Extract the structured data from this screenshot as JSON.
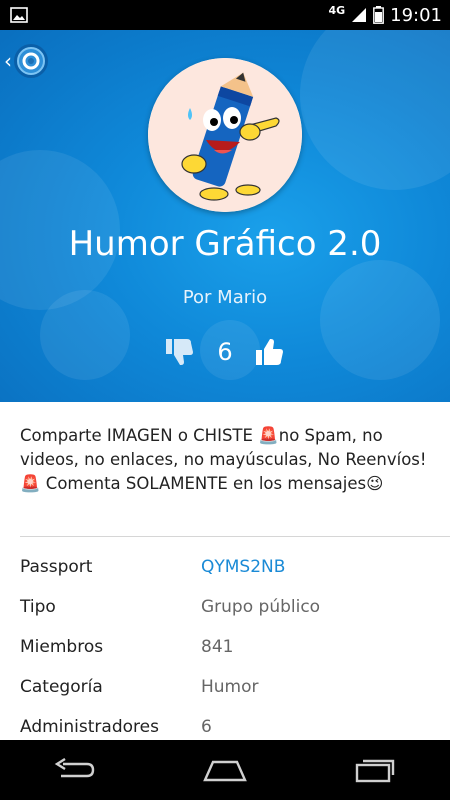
{
  "status_bar": {
    "network": "4G",
    "time": "19:01"
  },
  "group": {
    "title": "Humor Gráfico 2.0",
    "author": "Por Mario",
    "vote_count": "6",
    "description_parts": [
      "Comparte IMAGEN o CHISTE ",
      "🚨",
      "no Spam, no videos, no enlaces, no mayúsculas, No Reenvíos!",
      "🚨",
      " Comenta SOLAMENTE en los mensajes",
      "😉"
    ]
  },
  "info": {
    "rows": [
      {
        "label": "Passport",
        "value": "QYMS2NB"
      },
      {
        "label": "Tipo",
        "value": "Grupo público"
      },
      {
        "label": "Miembros",
        "value": "841"
      },
      {
        "label": "Categoría",
        "value": "Humor"
      },
      {
        "label": "Administradores",
        "value": "6"
      }
    ]
  },
  "colors": {
    "header_blue": "#0f88d8",
    "link_blue": "#1a8ad6"
  },
  "icons": {
    "back": "chevron-left-icon",
    "app_logo": "app-logo-icon",
    "dislike": "thumbs-down-icon",
    "like": "thumbs-up-icon",
    "nav_back": "nav-back-icon",
    "nav_home": "nav-home-icon",
    "nav_recents": "nav-recents-icon"
  }
}
